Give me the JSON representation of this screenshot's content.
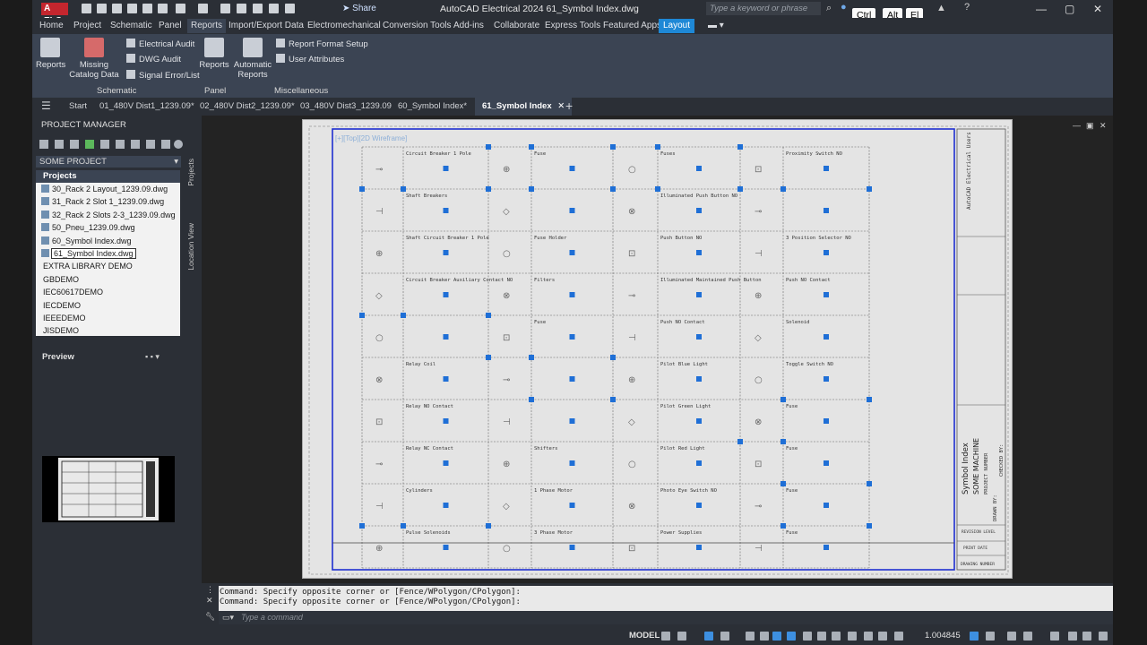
{
  "app": {
    "logo_text": "A ELC",
    "title": "AutoCAD Electrical 2024   61_Symbol Index.dwg",
    "share_label": "Share",
    "search_placeholder": "Type a keyword or phrase",
    "keycaps": [
      "Ctrl",
      "Alt",
      "El"
    ]
  },
  "menu_tabs": [
    "Home",
    "Project",
    "Schematic",
    "Panel",
    "Reports",
    "Import/Export Data",
    "Electromechanical",
    "Conversion Tools",
    "Add-ins",
    "Collaborate",
    "Express Tools",
    "Featured Apps",
    "Layout"
  ],
  "ribbon": {
    "schematic": {
      "title": "Schematic",
      "reports": "Reports",
      "missing_catalog": "Missing Catalog Data",
      "electrical_audit": "Electrical Audit",
      "dwg_audit": "DWG Audit",
      "signal_error": "Signal Error/List"
    },
    "panel": {
      "title": "Panel",
      "reports": "Reports"
    },
    "misc": {
      "title": "Miscellaneous",
      "automatic_reports": "Automatic Reports",
      "report_format_setup": "Report Format Setup",
      "user_attributes": "User Attributes"
    }
  },
  "doc_tabs": [
    "Start",
    "01_480V Dist1_1239.09*",
    "02_480V Dist2_1239.09*",
    "03_480V Dist3_1239.09",
    "60_Symbol Index*",
    "61_Symbol Index"
  ],
  "project_manager": {
    "title": "PROJECT MANAGER",
    "project_dropdown": "SOME PROJECT",
    "projects_header": "Projects",
    "files": [
      "30_Rack 2 Layout_1239.09.dwg",
      "31_Rack 2 Slot 1_1239.09.dwg",
      "32_Rack 2 Slots 2-3_1239.09.dwg",
      "50_Pneu_1239.09.dwg",
      "60_Symbol Index.dwg",
      "61_Symbol Index.dwg"
    ],
    "libraries": [
      "EXTRA LIBRARY DEMO",
      "GBDEMO",
      "IEC60617DEMO",
      "IECDEMO",
      "IEEEDEMO",
      "JISDEMO"
    ],
    "side_tabs": [
      "Projects",
      "Location View"
    ],
    "preview_header": "Preview"
  },
  "drawing": {
    "view_label": "[+][Top][2D Wireframe]",
    "cells": [
      [
        "",
        "Circuit Breaker 1 Pole",
        "",
        "Fuse",
        "",
        "Fuses",
        "",
        "Proximity Switch NO"
      ],
      [
        "",
        "Shaft Breakers",
        "",
        "",
        "",
        "Illuminated Push Button NO",
        "",
        ""
      ],
      [
        "",
        "Shaft Circuit Breaker 1 Pole",
        "",
        "Fuse Holder",
        "",
        "Push Button NO",
        "",
        "3 Position Selector NO"
      ],
      [
        "",
        "Circuit Breaker Auxiliary Contact NO",
        "",
        "Filters",
        "",
        "Illuminated Maintained Push Button",
        "",
        "Push NO Contact"
      ],
      [
        "",
        "",
        "",
        "Fuse",
        "",
        "Push NO Contact",
        "",
        "Solenoid"
      ],
      [
        "",
        "Relay Coil",
        "",
        "",
        "",
        "Pilot Blue Light",
        "",
        "Toggle Switch NO"
      ],
      [
        "",
        "Relay NO Contact",
        "",
        "",
        "",
        "Pilot Green Light",
        "",
        "Fuse"
      ],
      [
        "",
        "Relay NC Contact",
        "",
        "Shifters",
        "",
        "Pilot Red Light",
        "",
        "Fuse"
      ],
      [
        "",
        "Cylinders",
        "",
        "1 Phase Motor",
        "",
        "Photo Eye Switch NO",
        "",
        "Fuse"
      ],
      [
        "",
        "Pulse Solenoids",
        "",
        "3 Phase Motor",
        "",
        "Power Supplies",
        "",
        "Fuse"
      ]
    ],
    "title_block": {
      "company": "AutoCAD Electrical Users",
      "sheet_title": "Symbol Index",
      "machine": "SOME MACHINE",
      "project_number": "PROJECT NUMBER",
      "drawn_by": "DRAWN BY:",
      "checked_by": "CHECKED BY:",
      "revision": "REVISION LEVEL",
      "print_date": "PRINT DATE",
      "drawing_number": "DRAWING NUMBER"
    }
  },
  "command": {
    "history": [
      "Command: Specify opposite corner or [Fence/WPolygon/CPolygon]:",
      "Command: Specify opposite corner or [Fence/WPolygon/CPolygon]:"
    ],
    "placeholder": "Type a command"
  },
  "status": {
    "model_label": "MODEL",
    "scale": "1.004845"
  }
}
